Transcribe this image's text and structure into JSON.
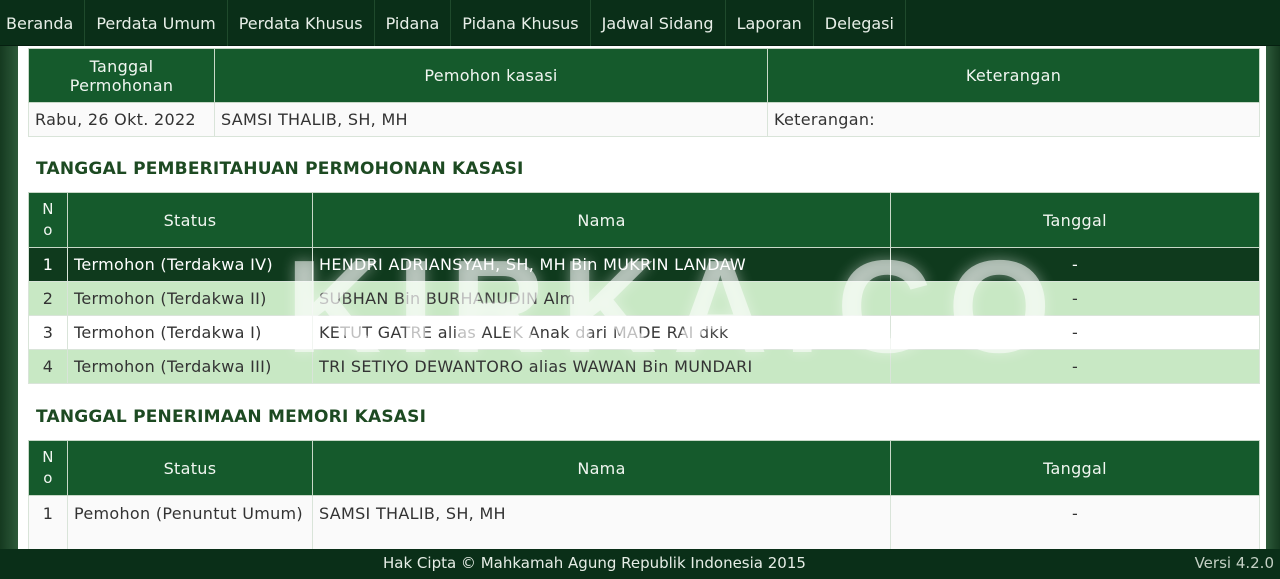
{
  "nav": [
    "Beranda",
    "Perdata Umum",
    "Perdata Khusus",
    "Pidana",
    "Pidana Khusus",
    "Jadwal Sidang",
    "Laporan",
    "Delegasi"
  ],
  "permohonan": {
    "headers": [
      "Tanggal Permohonan",
      "Pemohon kasasi",
      "Keterangan"
    ],
    "header_line1": "Tanggal",
    "header_line2": "Permohonan",
    "row": [
      "Rabu, 26 Okt. 2022",
      "SAMSI THALIB, SH, MH",
      "Keterangan:"
    ]
  },
  "pemberitahuan": {
    "title": "TANGGAL PEMBERITAHUAN PERMOHONAN KASASI",
    "headers": [
      "No",
      "Status",
      "Nama",
      "Tanggal"
    ],
    "no_line1": "N",
    "no_line2": "o",
    "rows": [
      [
        "1",
        "Termohon (Terdakwa IV)",
        "HENDRI ADRIANSYAH, SH, MH Bin MUKRIN LANDAW",
        "-"
      ],
      [
        "2",
        "Termohon (Terdakwa II)",
        "SUBHAN Bin BURHANUDIN Alm",
        "-"
      ],
      [
        "3",
        "Termohon (Terdakwa I)",
        "KETUT GATRE alias ALEK Anak dari MADE RAI dkk",
        "-"
      ],
      [
        "4",
        "Termohon (Terdakwa III)",
        "TRI SETIYO DEWANTORO alias WAWAN Bin MUNDARI",
        "-"
      ]
    ]
  },
  "memori": {
    "title": "TANGGAL PENERIMAAN MEMORI KASASI",
    "headers": [
      "No",
      "Status",
      "Nama",
      "Tanggal"
    ],
    "no_line1": "N",
    "no_line2": "o",
    "rows": [
      [
        "1",
        "Pemohon (Penuntut Umum)",
        "SAMSI THALIB, SH, MH",
        "-"
      ]
    ]
  },
  "watermark": "KIRKA.CO",
  "footer": {
    "copyright": "Hak Cipta © Mahkamah Agung Republik Indonesia 2015",
    "version": "Versi 4.2.0"
  },
  "colors": {
    "header_bg": "#155a2c",
    "nav_bg": "#0a2f18",
    "row_dark": "#0f3a1d",
    "row_light": "#c8e8c4",
    "title_color": "#1d4a22"
  }
}
